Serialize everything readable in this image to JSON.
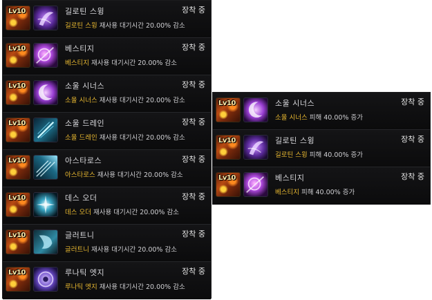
{
  "left_panel": {
    "items": [
      {
        "level": "Lv10",
        "icon": "guillotine-swing-icon",
        "name": "길로틴 스윙",
        "status": "장착 중",
        "desc_skill": "길로틴 스윙",
        "desc_text": " 재사용 대기시간 20.00% 감소"
      },
      {
        "level": "Lv10",
        "icon": "vestige-icon",
        "name": "베스티지",
        "status": "장착 중",
        "desc_skill": "베스티지",
        "desc_text": " 재사용 대기시간 20.00% 감소"
      },
      {
        "level": "Lv10",
        "icon": "soul-sinus-icon",
        "name": "소울 시너스",
        "status": "장착 중",
        "desc_skill": "소울 시너스",
        "desc_text": " 재사용 대기시간 20.00% 감소"
      },
      {
        "level": "Lv10",
        "icon": "soul-drain-icon",
        "name": "소울 드레인",
        "status": "장착 중",
        "desc_skill": "소울 드레인",
        "desc_text": " 재사용 대기시간 20.00% 감소"
      },
      {
        "level": "Lv10",
        "icon": "astaros-icon",
        "name": "아스타로스",
        "status": "장착 중",
        "desc_skill": "아스타로스",
        "desc_text": " 재사용 대기시간 20.00% 감소"
      },
      {
        "level": "Lv10",
        "icon": "death-order-icon",
        "name": "데스 오더",
        "status": "장착 중",
        "desc_skill": "데스 오더",
        "desc_text": " 재사용 대기시간 20.00% 감소"
      },
      {
        "level": "Lv10",
        "icon": "gluttony-icon",
        "name": "글러트니",
        "status": "장착 중",
        "desc_skill": "글러트니",
        "desc_text": " 재사용 대기시간 20.00% 감소"
      },
      {
        "level": "Lv10",
        "icon": "lunatic-edge-icon",
        "name": "루나틱 엣지",
        "status": "장착 중",
        "desc_skill": "루나틱 엣지",
        "desc_text": " 재사용 대기시간 20.00% 감소"
      }
    ]
  },
  "right_panel": {
    "items": [
      {
        "level": "Lv10",
        "icon": "soul-sinus-icon",
        "name": "소울 시너스",
        "status": "장착 중",
        "desc_skill": "소울 시너스",
        "desc_text": " 피해 40.00% 증가"
      },
      {
        "level": "Lv10",
        "icon": "guillotine-swing-icon",
        "name": "길로틴 스윙",
        "status": "장착 중",
        "desc_skill": "길로틴 스윙",
        "desc_text": " 피해 40.00% 증가"
      },
      {
        "level": "Lv10",
        "icon": "vestige-icon",
        "name": "베스티지",
        "status": "장착 중",
        "desc_skill": "베스티지",
        "desc_text": " 피해 40.00% 증가"
      }
    ]
  },
  "colors": {
    "highlight": "#e8b830",
    "text": "#cfcfd2",
    "panel_bg": "#0d0d0e"
  }
}
